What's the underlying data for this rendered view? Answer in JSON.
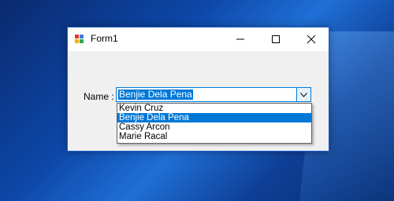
{
  "window": {
    "title": "Form1"
  },
  "form": {
    "name_label": "Name :",
    "selected_value": "Benjie Dela Pena",
    "options": [
      "Kevin Cruz",
      "Benjie Dela Pena",
      "Cassy Arcon",
      "Marie Racal"
    ],
    "selected_index": 1
  },
  "colors": {
    "accent": "#0078d7",
    "window_border": "#1f5bc4"
  }
}
